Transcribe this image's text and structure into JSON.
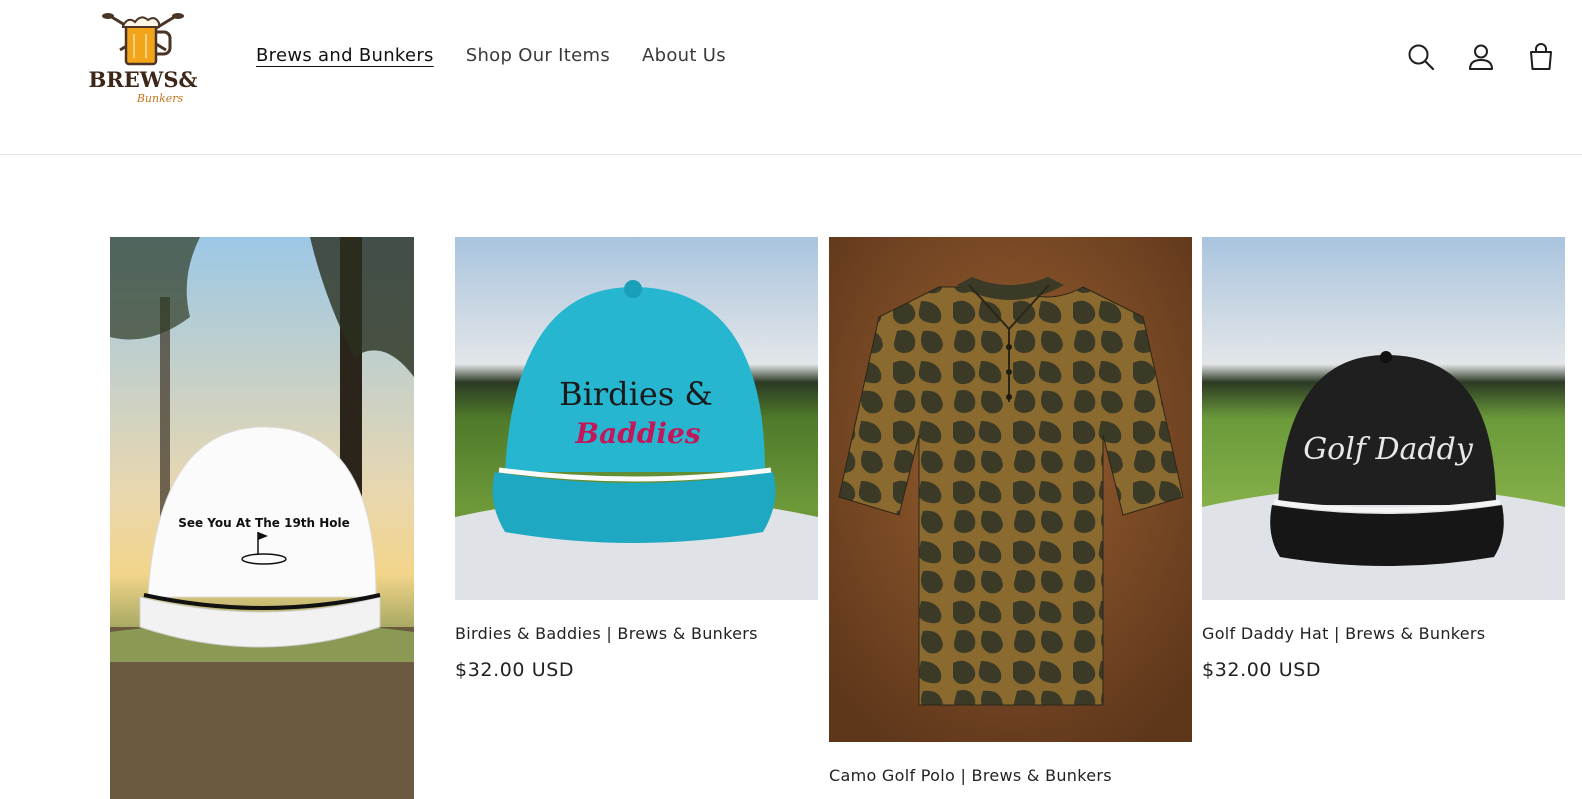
{
  "brand": {
    "logo_line1": "BREWS&",
    "logo_line2": "Bunkers",
    "logo_icon": "beer-mug-with-golf-clubs-icon"
  },
  "nav": {
    "items": [
      {
        "label": "Brews and Bunkers",
        "active": true
      },
      {
        "label": "Shop Our Items",
        "active": false
      },
      {
        "label": "About Us",
        "active": false
      }
    ]
  },
  "header_icons": [
    "search-icon",
    "account-icon",
    "cart-icon"
  ],
  "products": [
    {
      "image_text": "See You At The 19th Hole",
      "image_desc_icon": "white-rope-hat-image"
    },
    {
      "title": "Birdies & Baddies | Brews & Bunkers",
      "price": "$32.00 USD",
      "image_text_1": "Birdies &",
      "image_text_2": "Baddies"
    },
    {
      "title": "Camo Golf Polo | Brews & Bunkers",
      "image_desc_icon": "camo-polo-image"
    },
    {
      "title": "Golf Daddy Hat | Brews & Bunkers",
      "price": "$32.00 USD",
      "image_text": "Golf Daddy"
    }
  ],
  "colors": {
    "teal_hat": "#27b6d0",
    "pink_text": "#c2185b",
    "camo_dark": "#3b3a27",
    "camo_light": "#8a6a2e",
    "polo_bg": "#7a4a24"
  }
}
